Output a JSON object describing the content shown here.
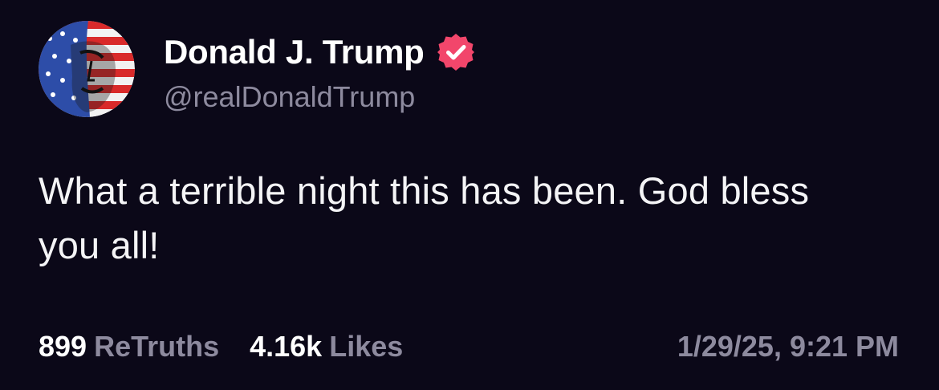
{
  "post": {
    "author": {
      "display_name": "Donald J. Trump",
      "handle": "@realDonaldTrump",
      "verified": true,
      "avatar_icon": "flag-portrait-avatar",
      "verified_icon": "verified-badge-icon"
    },
    "content": "What a terrible night this has been. God bless you all!",
    "stats": {
      "retruths_count": "899",
      "retruths_label": "ReTruths",
      "likes_count": "4.16k",
      "likes_label": "Likes"
    },
    "timestamp": "1/29/25, 9:21 PM"
  },
  "colors": {
    "background": "#0b0818",
    "primary_text": "#ffffff",
    "secondary_text": "#8d8a9e",
    "verified_badge": "#f2466b"
  }
}
